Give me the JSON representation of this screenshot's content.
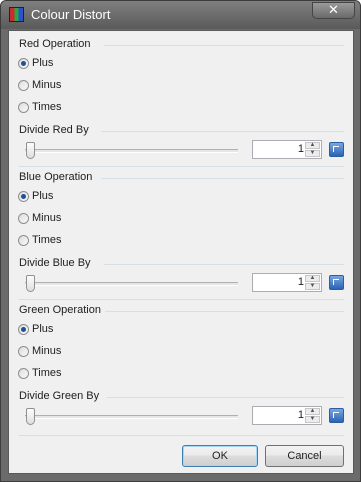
{
  "window": {
    "title": "Colour Distort",
    "close_glyph": "✕"
  },
  "groups": [
    {
      "op_label": "Red Operation",
      "options": [
        "Plus",
        "Minus",
        "Times"
      ],
      "selected": "Plus",
      "divide_label": "Divide Red By",
      "value": "1"
    },
    {
      "op_label": "Blue Operation",
      "options": [
        "Plus",
        "Minus",
        "Times"
      ],
      "selected": "Plus",
      "divide_label": "Divide Blue By",
      "value": "1"
    },
    {
      "op_label": "Green Operation",
      "options": [
        "Plus",
        "Minus",
        "Times"
      ],
      "selected": "Plus",
      "divide_label": "Divide Green By",
      "value": "1"
    }
  ],
  "buttons": {
    "ok": "OK",
    "cancel": "Cancel"
  },
  "icons": {
    "app": "color-channels-icon",
    "close": "close-icon",
    "spin_up": "arrow-up-icon",
    "spin_down": "arrow-down-icon",
    "reset": "reset-icon"
  }
}
